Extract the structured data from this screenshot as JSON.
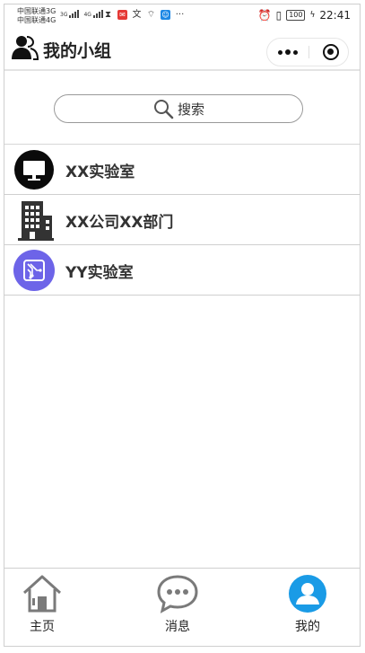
{
  "status_bar": {
    "carrier_1": "中国联通3G",
    "carrier_2": "中国联通4G",
    "net_1": "3G",
    "net_2": "4G",
    "overflow": "···",
    "battery": "100",
    "time": "22:41"
  },
  "nav": {
    "title": "我的小组"
  },
  "search": {
    "placeholder": "搜索"
  },
  "groups": [
    {
      "name": "XX实验室",
      "icon": "monitor-icon"
    },
    {
      "name": "XX公司XX部门",
      "icon": "building-icon"
    },
    {
      "name": "YY实验室",
      "icon": "circuit-icon"
    }
  ],
  "tabs": [
    {
      "label": "主页",
      "icon": "home-icon"
    },
    {
      "label": "消息",
      "icon": "chat-bubble-icon"
    },
    {
      "label": "我的",
      "icon": "user-avatar-icon",
      "active": true
    }
  ],
  "colors": {
    "accent": "#1a9be6",
    "purple": "#6d64e8",
    "icon_dark": "#111111",
    "icon_gray": "#8a8a8a"
  }
}
